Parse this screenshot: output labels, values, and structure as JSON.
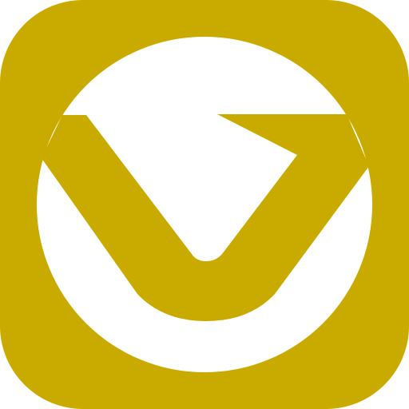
{
  "icon": {
    "semantic": "app-logo-icon",
    "shape": "rounded-square with circle and checkmark-v glyph",
    "colors": {
      "tile": "#c9ab00",
      "circle": "#ffffff",
      "glyph": "#c9ab00"
    }
  }
}
